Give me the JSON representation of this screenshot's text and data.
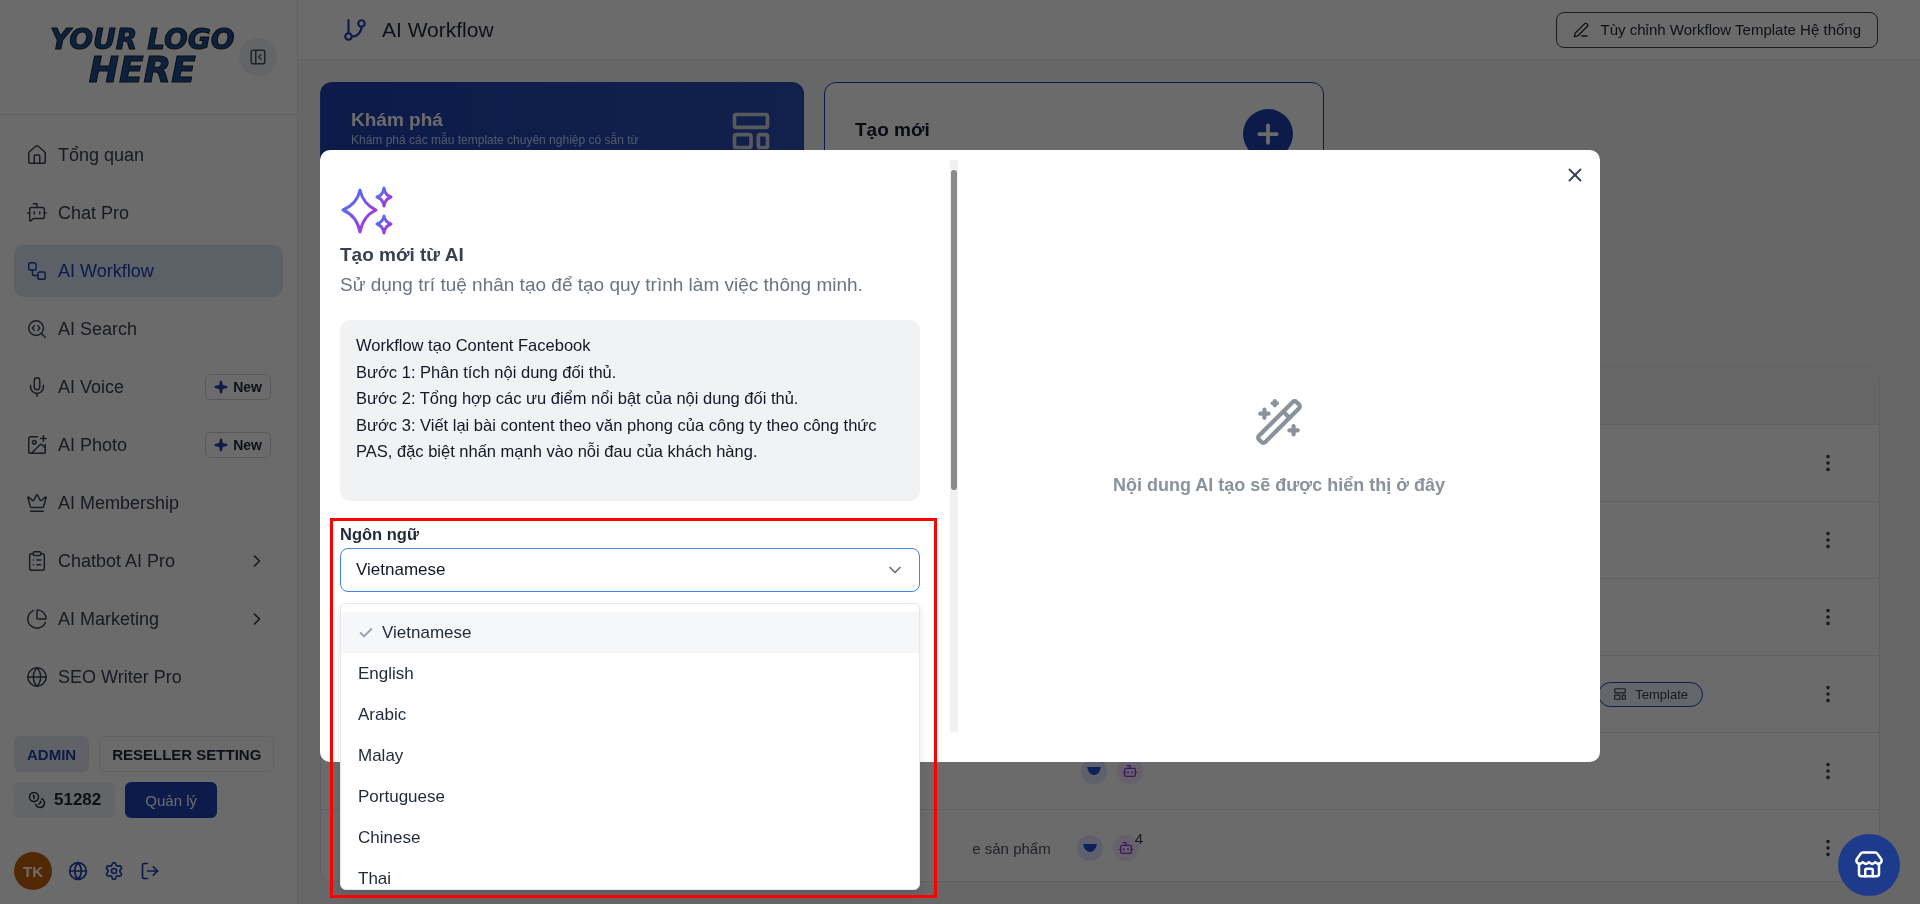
{
  "sidebar": {
    "logo": {
      "line_1": "YOUR LOGO",
      "line_2": "HERE"
    },
    "items": [
      {
        "label": "Tổng quan",
        "selected": false
      },
      {
        "label": "Chat Pro",
        "selected": false
      },
      {
        "label": "AI Workflow",
        "selected": true
      },
      {
        "label": "AI Search",
        "selected": false
      },
      {
        "label": "AI Voice",
        "selected": false,
        "badge": "New"
      },
      {
        "label": "AI Photo",
        "selected": false,
        "badge": "New"
      },
      {
        "label": "AI Membership",
        "selected": false
      },
      {
        "label": "Chatbot AI Pro",
        "selected": false,
        "expandable": true
      },
      {
        "label": "AI Marketing",
        "selected": false,
        "expandable": true
      },
      {
        "label": "SEO Writer Pro",
        "selected": false
      }
    ],
    "role_buttons": [
      {
        "label": "ADMIN",
        "selected": true
      },
      {
        "label": "RESELLER SETTING",
        "selected": false
      }
    ],
    "credits": "51282",
    "manage_button": "Quản lý",
    "avatar": "TK"
  },
  "header": {
    "title": "AI Workflow",
    "action_button": "Tùy chỉnh Workflow Template Hệ thống"
  },
  "cards": [
    {
      "kind": "explore",
      "title": "Khám phá",
      "subtitle": "Khám phá các mẫu template chuyên nghiệp có sẵn từ"
    },
    {
      "kind": "create",
      "title": "Tạo mới"
    }
  ],
  "table": {
    "rows": [
      {},
      {},
      {},
      {
        "tag": "Template"
      },
      {
        "icons": true
      },
      {
        "text": "e sản phẩm",
        "icons": true,
        "count": "4"
      }
    ]
  },
  "modal": {
    "title": "Tạo mới từ AI",
    "subtitle": "Sử dụng trí tuệ nhân tạo để tạo quy trình làm việc thông minh.",
    "prompt": [
      "Workflow tạo Content Facebook",
      "Bước 1: Phân tích nội dung đối thủ.",
      "Bước 2: Tổng hợp các ưu điểm nổi bật của nội dung đối thủ.",
      "Bước 3: Viết lại bài content theo văn phong của công ty theo công thức PAS, đặc biệt nhấn mạnh vào nỗi đau của khách hàng."
    ],
    "language_label": "Ngôn ngữ",
    "language_value": "Vietnamese",
    "language_options": [
      {
        "label": "Vietnamese",
        "selected": true
      },
      {
        "label": "English",
        "selected": false
      },
      {
        "label": "Arabic",
        "selected": false
      },
      {
        "label": "Malay",
        "selected": false
      },
      {
        "label": "Portuguese",
        "selected": false
      },
      {
        "label": "Chinese",
        "selected": false
      },
      {
        "label": "Thai",
        "selected": false
      }
    ],
    "empty_text": "Nội dung AI tạo sẽ được hiển thị ở đây"
  }
}
